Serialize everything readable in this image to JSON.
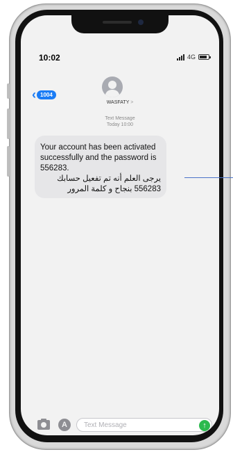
{
  "status_bar": {
    "time": "10:02",
    "network": "4G"
  },
  "nav": {
    "back_count": "1004",
    "contact_name": "WASFATY",
    "contact_chevron": ">"
  },
  "conversation": {
    "meta_line1": "Text Message",
    "meta_line2": "Today 10:00",
    "messages": [
      {
        "text_en": "Your account has been activated successfully and the password is 556283.",
        "text_ar_line1": "يرجى العلم أنه تم تفعيل حسابك",
        "text_ar_line2": "556283 بنجاح و كلمة المرور"
      }
    ]
  },
  "input_bar": {
    "placeholder": "Text Message"
  },
  "colors": {
    "accent": "#1a7cf5",
    "send": "#2cba4e",
    "bubble": "#e6e6e8"
  }
}
